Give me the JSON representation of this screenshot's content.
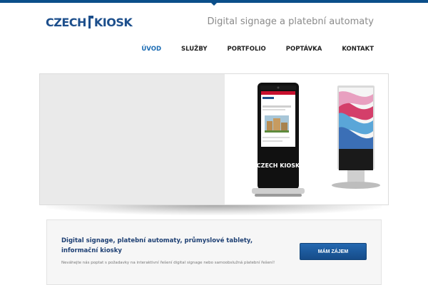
{
  "header": {
    "logo_left": "CZECH",
    "logo_right": "KIOSK",
    "tagline": "Digital signage a platební automaty"
  },
  "nav": {
    "items": [
      {
        "label": "ÚVOD",
        "active": true
      },
      {
        "label": "SLUŽBY",
        "active": false
      },
      {
        "label": "PORTFOLIO",
        "active": false
      },
      {
        "label": "POPTÁVKA",
        "active": false
      },
      {
        "label": "KONTAKT",
        "active": false
      }
    ]
  },
  "hero": {
    "kiosk_brand": "CZECH KIOSK"
  },
  "callout": {
    "title": "Digital signage, platební automaty, průmyslové tablety, informační kiosky",
    "text": "Neváhejte nás poptat s požadavky na interaktivní řešení digital signage nebo samoobslužná platební řešení!",
    "button_label": "MÁM ZÁJEM"
  },
  "colors": {
    "brand": "#1d4f8c",
    "accent": "#1a6bb3",
    "button": "#1b5aa0"
  }
}
